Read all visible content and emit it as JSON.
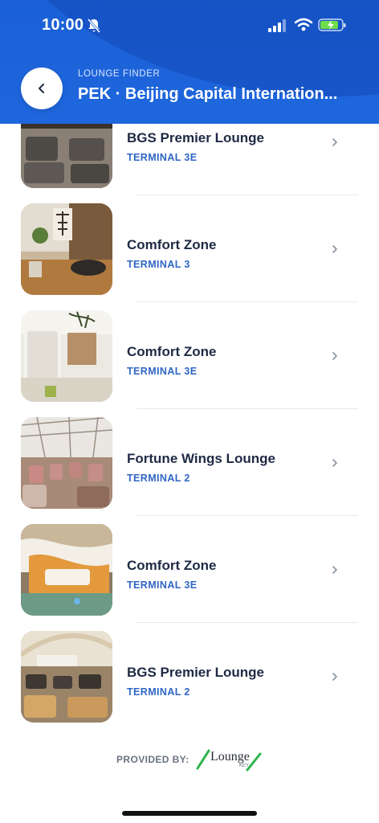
{
  "status_bar": {
    "time": "10:00"
  },
  "header": {
    "eyebrow": "LOUNGE FINDER",
    "title": "PEK · Beijing Capital Internation..."
  },
  "lounges": [
    {
      "name": "BGS Premier Lounge",
      "terminal": "TERMINAL 3E"
    },
    {
      "name": "Comfort Zone",
      "terminal": "TERMINAL 3"
    },
    {
      "name": "Comfort Zone",
      "terminal": "TERMINAL 3E"
    },
    {
      "name": "Fortune Wings Lounge",
      "terminal": "TERMINAL 2"
    },
    {
      "name": "Comfort Zone",
      "terminal": "TERMINAL 3E"
    },
    {
      "name": "BGS Premier Lounge",
      "terminal": "TERMINAL 2"
    }
  ],
  "footer": {
    "provided_by": "PROVIDED BY:",
    "logo_text": "Lounge",
    "logo_sub": "KEY"
  },
  "colors": {
    "header_blue": "#1f67dd",
    "terminal_blue": "#2f66c4",
    "title_dark": "#1e2a44",
    "logo_green": "#2bb34a"
  }
}
